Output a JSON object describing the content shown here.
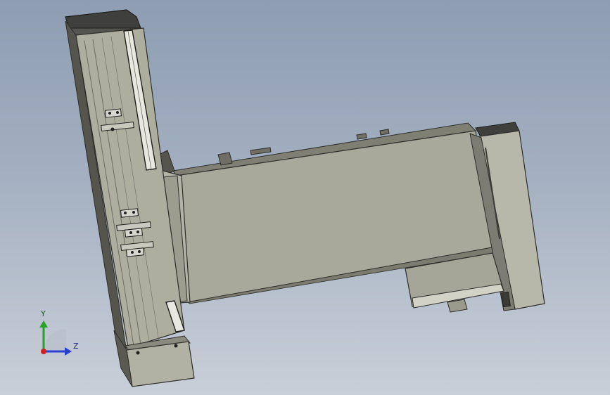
{
  "triad": {
    "y_label": "Y",
    "z_label": "Z"
  },
  "colors": {
    "background_top": "#8e9db2",
    "background_bottom": "#c9cfd8",
    "body": "#a9a99b",
    "body_light": "#b6b6a9",
    "body_dark": "#8f8f82",
    "edge": "#2d2d2a",
    "cap": "#3f3f3d",
    "axis_y": "#2aa02a",
    "axis_z": "#2a3fd0",
    "axis_x": "#d02020"
  }
}
